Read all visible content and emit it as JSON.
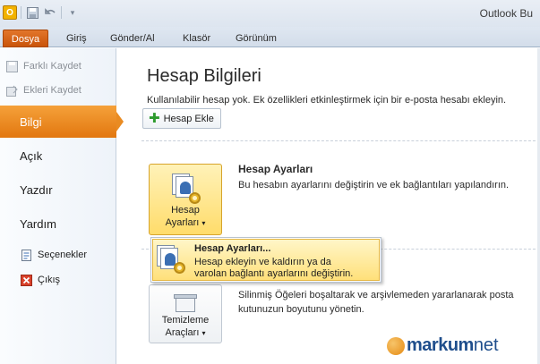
{
  "window": {
    "title": "Outlook Bu"
  },
  "qat": {
    "app_icon_label": "O"
  },
  "ribbon": {
    "tabs": [
      {
        "label": "Dosya"
      },
      {
        "label": "Giriş"
      },
      {
        "label": "Gönder/Al"
      },
      {
        "label": "Klasör"
      },
      {
        "label": "Görünüm"
      }
    ]
  },
  "nav": {
    "save_as": "Farklı Kaydet",
    "save_attachments": "Ekleri Kaydet",
    "items": [
      {
        "label": "Bilgi"
      },
      {
        "label": "Açık"
      },
      {
        "label": "Yazdır"
      },
      {
        "label": "Yardım"
      }
    ],
    "options": "Seçenekler",
    "exit": "Çıkış"
  },
  "main": {
    "title": "Hesap Bilgileri",
    "subtitle": "Kullanılabilir hesap yok. Ek özellikleri etkinleştirmek için bir e-posta hesabı ekleyin.",
    "add_account": "Hesap Ekle",
    "account_settings": {
      "button_line1": "Hesap",
      "button_line2": "Ayarları",
      "heading": "Hesap Ayarları",
      "description": "Bu hesabın ayarlarını değiştirin ve ek bağlantıları yapılandırın."
    },
    "dropdown": {
      "title": "Hesap Ayarları...",
      "desc_line1": "Hesap ekleyin ve kaldırın ya da",
      "desc_line2": "varolan bağlantı ayarlarını değiştirin."
    },
    "cleanup": {
      "description_line1": "Silinmiş Öğeleri boşaltarak ve arşivlemeden yararlanarak posta",
      "description_line2": "kutunuzun boyutunu yönetin.",
      "button_line1": "Temizleme",
      "button_line2": "Araçları"
    }
  },
  "watermark": {
    "brand": "markum",
    "tld": "net"
  }
}
